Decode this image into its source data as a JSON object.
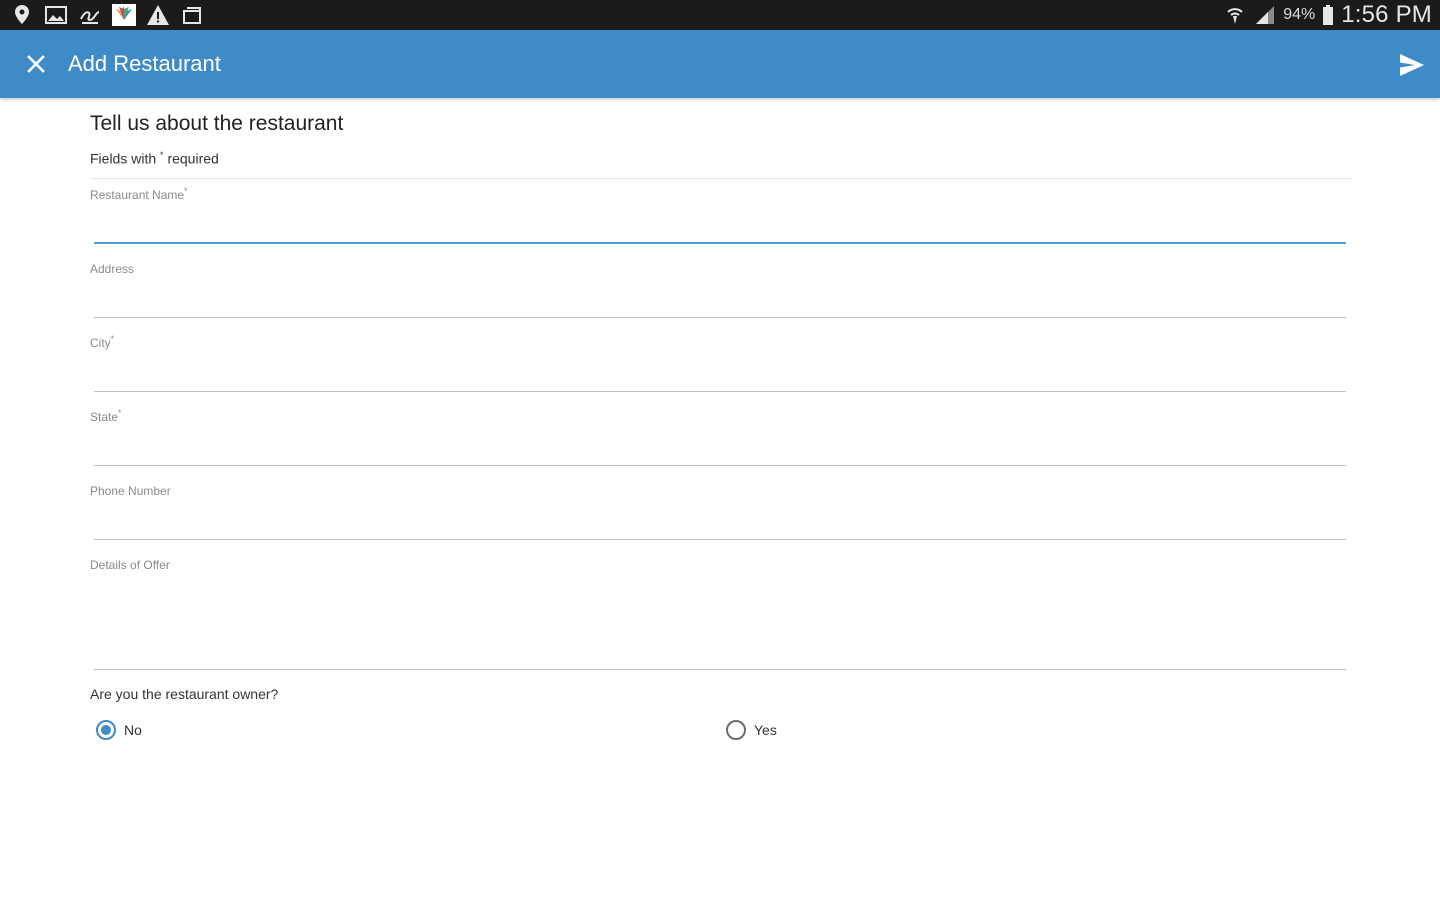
{
  "status_bar": {
    "left_icons": [
      "location-pin-icon",
      "image-icon",
      "gesture-icon",
      "nbc-icon",
      "warning-icon",
      "stack-icon"
    ],
    "battery_percent": "94%",
    "time": "1:56 PM"
  },
  "appbar": {
    "title": "Add Restaurant",
    "close_icon": "close-icon",
    "send_icon": "send-icon"
  },
  "form": {
    "heading": "Tell us about the restaurant",
    "note_prefix": "Fields with",
    "note_mark": "*",
    "note_suffix": "required",
    "fields": [
      {
        "label": "Restaurant Name",
        "required": "*",
        "value": ""
      },
      {
        "label": "Address",
        "required": "",
        "value": ""
      },
      {
        "label": "City",
        "required": "*",
        "value": ""
      },
      {
        "label": "State",
        "required": "*",
        "value": ""
      },
      {
        "label": "Phone Number",
        "required": "",
        "value": ""
      },
      {
        "label": "Details of Offer",
        "required": "",
        "value": ""
      }
    ],
    "owner_question": "Are you the restaurant owner?",
    "owner_options": [
      {
        "label": "No",
        "selected": true
      },
      {
        "label": "Yes",
        "selected": false
      }
    ]
  },
  "colors": {
    "appbar": "#3f8bc7",
    "statusbar": "#1b1b1b",
    "accent": "#5a9ad4"
  }
}
